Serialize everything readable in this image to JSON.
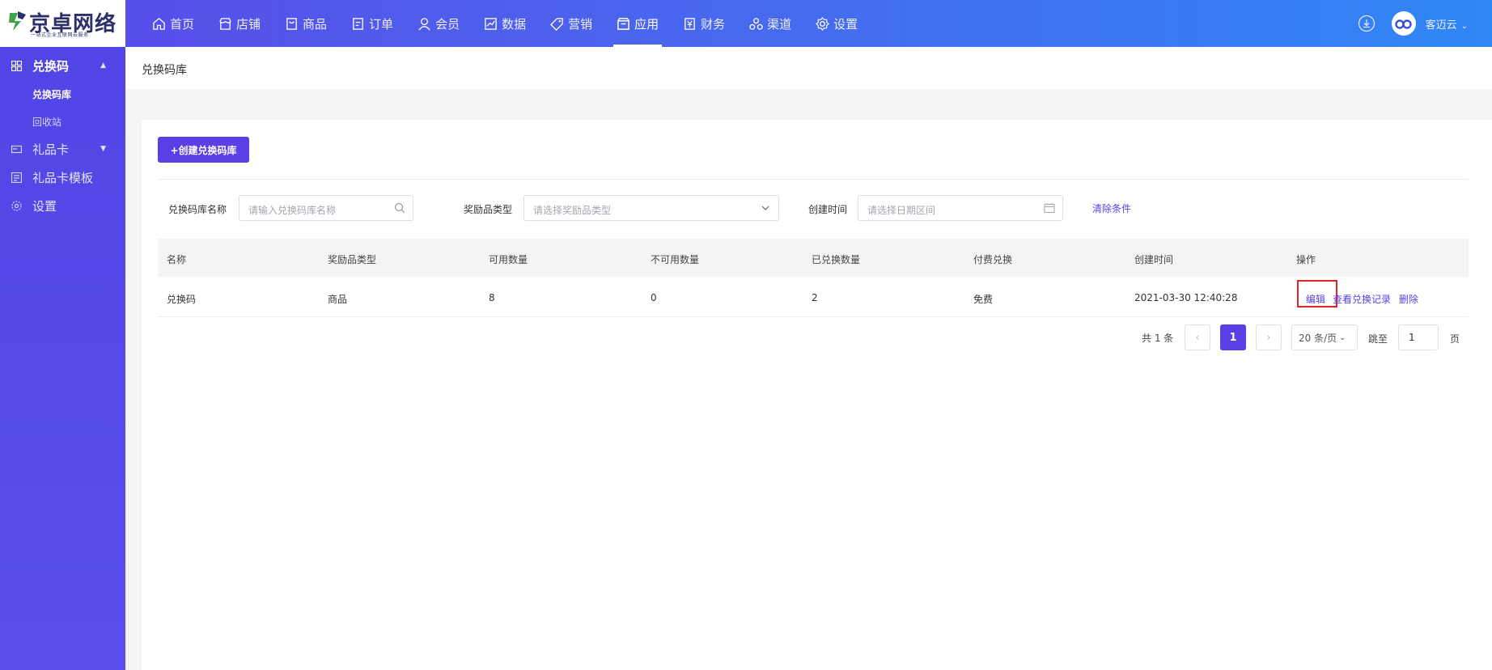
{
  "brand": {
    "name": "京卓网络",
    "slogan": "一站式企业互联网云服务"
  },
  "nav": [
    {
      "label": "首页",
      "icon": "home-icon",
      "active": false
    },
    {
      "label": "店铺",
      "icon": "store-icon",
      "active": false
    },
    {
      "label": "商品",
      "icon": "product-icon",
      "active": false
    },
    {
      "label": "订单",
      "icon": "order-icon",
      "active": false
    },
    {
      "label": "会员",
      "icon": "user-icon",
      "active": false
    },
    {
      "label": "数据",
      "icon": "chart-icon",
      "active": false
    },
    {
      "label": "营销",
      "icon": "tag-icon",
      "active": false
    },
    {
      "label": "应用",
      "icon": "app-icon",
      "active": true
    },
    {
      "label": "财务",
      "icon": "finance-icon",
      "active": false
    },
    {
      "label": "渠道",
      "icon": "channel-icon",
      "active": false
    },
    {
      "label": "设置",
      "icon": "gear-icon",
      "active": false
    }
  ],
  "user": {
    "name": "客迈云"
  },
  "sidebar": {
    "items": [
      {
        "label": "兑换码",
        "icon": "grid-icon",
        "expanded": true,
        "children": [
          {
            "label": "兑换码库",
            "active": true
          },
          {
            "label": "回收站",
            "active": false
          }
        ]
      },
      {
        "label": "礼品卡",
        "icon": "card-icon",
        "expanded": false
      },
      {
        "label": "礼品卡模板",
        "icon": "template-icon",
        "expanded": false
      },
      {
        "label": "设置",
        "icon": "gear-icon",
        "expanded": false
      }
    ]
  },
  "breadcrumb": {
    "title": "兑换码库"
  },
  "toolbar": {
    "create_label": "+创建兑换码库"
  },
  "filters": {
    "name_label": "兑换码库名称",
    "name_placeholder": "请输入兑换码库名称",
    "type_label": "奖励品类型",
    "type_placeholder": "请选择奖励品类型",
    "time_label": "创建时间",
    "time_placeholder": "请选择日期区间",
    "clear_label": "清除条件"
  },
  "table": {
    "columns": [
      "名称",
      "奖励品类型",
      "可用数量",
      "不可用数量",
      "已兑换数量",
      "付费兑换",
      "创建时间",
      "操作"
    ],
    "rows": [
      {
        "cells": [
          "兑换码",
          "商品",
          "8",
          "0",
          "2",
          "免费",
          "2021-03-30 12:40:28"
        ],
        "actions": [
          "编辑",
          "查看兑换记录",
          "删除"
        ]
      }
    ]
  },
  "pagination": {
    "total_text": "共 1 条",
    "prev": "‹",
    "current": "1",
    "next": "›",
    "page_size": "20 条/页",
    "goto_label": "跳至",
    "goto_value": "1",
    "page_label": "页"
  },
  "colors": {
    "accent": "#5a3fe6",
    "highlight": "#e32222"
  }
}
